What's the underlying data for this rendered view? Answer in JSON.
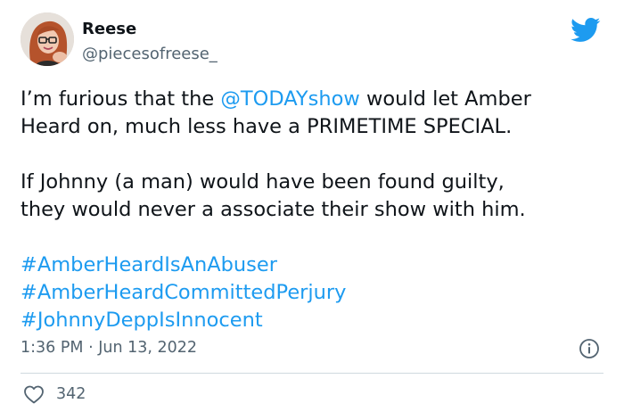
{
  "author": {
    "name": "Reese",
    "handle": "@piecesofreese_"
  },
  "tweet": {
    "line1_pre": "I’m furious that the ",
    "mention": "@TODAYshow",
    "line1_post": " would let Amber",
    "line2": "Heard on, much less have a PRIMETIME SPECIAL.",
    "line3": "If Johnny (a man) would have been found guilty,",
    "line4": "they would never a associate their show with him.",
    "hashtags": [
      "#AmberHeardIsAnAbuser",
      "#AmberHeardCommittedPerjury",
      "#JohnnyDeppIsInnocent"
    ]
  },
  "meta": {
    "timestamp": "1:36 PM · Jun 13, 2022"
  },
  "actions": {
    "like_count": "342"
  },
  "icons": {
    "brand": "twitter-bird-icon",
    "info": "info-icon",
    "like": "heart-icon"
  },
  "colors": {
    "link": "#1d9bf0",
    "text": "#0f1419",
    "secondary": "#536471",
    "brand": "#1d9bf0"
  }
}
